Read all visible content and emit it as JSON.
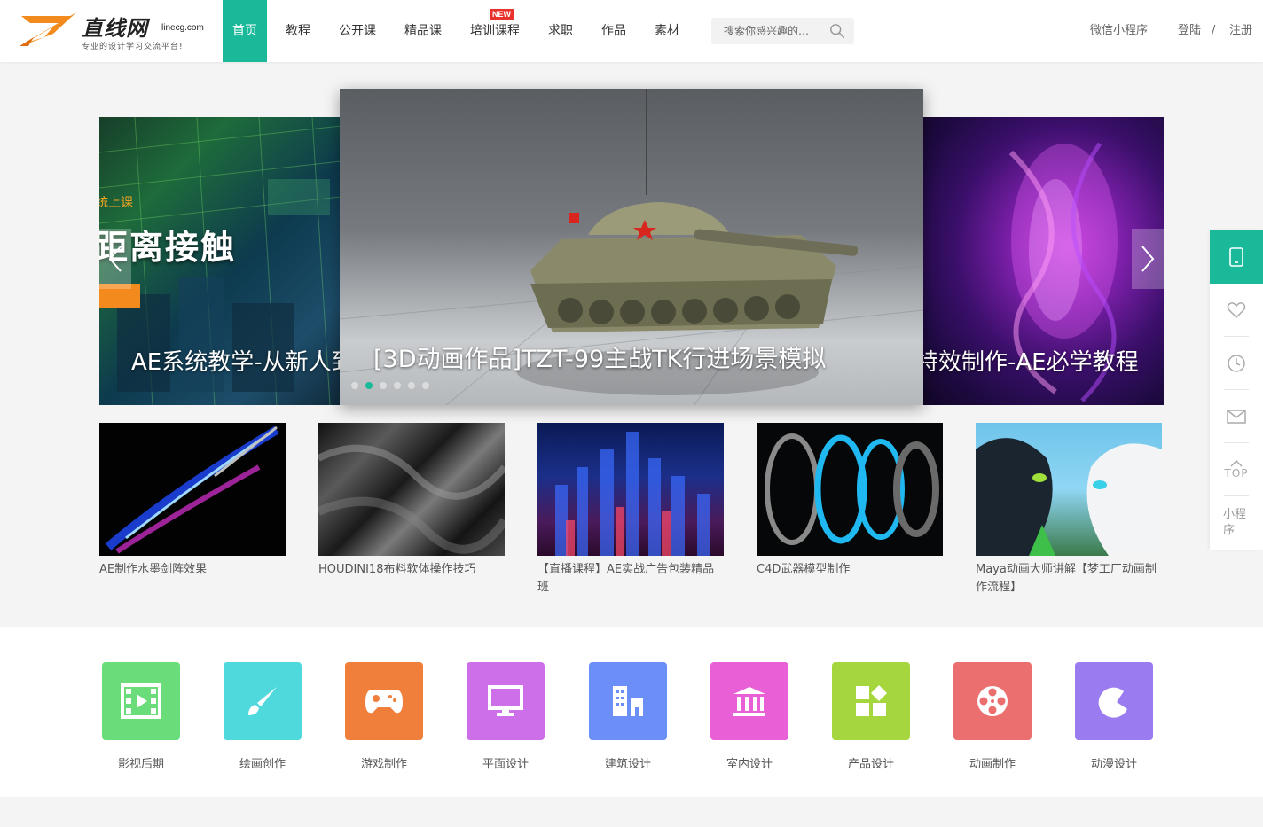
{
  "header": {
    "logo": {
      "name": "直线网",
      "domain": "linecg.com",
      "slogan": "专业的设计学习交流平台!"
    },
    "nav": [
      {
        "label": "首页",
        "active": true
      },
      {
        "label": "教程"
      },
      {
        "label": "公开课"
      },
      {
        "label": "精品课"
      },
      {
        "label": "培训课程",
        "badge": "NEW"
      },
      {
        "label": "求职"
      },
      {
        "label": "作品"
      },
      {
        "label": "素材"
      }
    ],
    "search": {
      "placeholder": "搜索你感兴趣的…",
      "icon": "search-icon"
    },
    "mini_program": "微信小程序",
    "login": "登陆",
    "separator": "/",
    "register": "注册"
  },
  "carousel": {
    "left_tagline": "统上课",
    "left_big_text": "距离接触",
    "left_title": "AE系统教学-从新人到",
    "center_title": "[3D动画作品]TZT-99主战TK行进场景模拟",
    "right_title": "特效制作-AE必学教程",
    "dot_count": 6,
    "active_dot": 1
  },
  "featured": [
    {
      "title": "AE制作水墨剑阵效果"
    },
    {
      "title": "HOUDINI18布料软体操作技巧"
    },
    {
      "title": "【直播课程】AE实战广告包装精品班"
    },
    {
      "title": "C4D武器模型制作"
    },
    {
      "title": "Maya动画大师讲解【梦工厂动画制作流程】"
    }
  ],
  "categories": [
    {
      "label": "影视后期",
      "color": "#6bdc7a",
      "icon": "film-icon"
    },
    {
      "label": "绘画创作",
      "color": "#4fd9dd",
      "icon": "brush-icon"
    },
    {
      "label": "游戏制作",
      "color": "#f07f3c",
      "icon": "gamepad-icon"
    },
    {
      "label": "平面设计",
      "color": "#cc6fe8",
      "icon": "monitor-icon"
    },
    {
      "label": "建筑设计",
      "color": "#6b8ff6",
      "icon": "building-icon"
    },
    {
      "label": "室内设计",
      "color": "#e95fd5",
      "icon": "interior-icon"
    },
    {
      "label": "产品设计",
      "color": "#a6d63e",
      "icon": "blocks-icon"
    },
    {
      "label": "动画制作",
      "color": "#ec6f6f",
      "icon": "film-reel-icon"
    },
    {
      "label": "动漫设计",
      "color": "#9a7bf0",
      "icon": "moon-icon"
    }
  ],
  "toolbar": {
    "top_label": "TOP",
    "mini_program_label": "小程序"
  }
}
